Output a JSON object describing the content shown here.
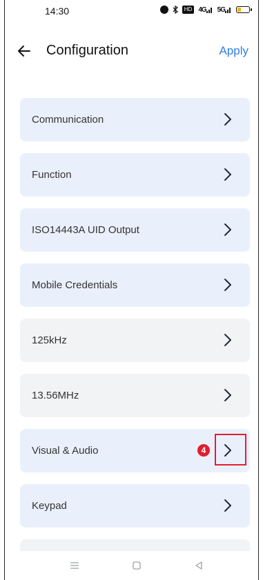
{
  "status": {
    "time": "14:30",
    "hd_label": "HD",
    "signal_1": "4G",
    "signal_2": "5G",
    "battery_level": 0.3
  },
  "header": {
    "title": "Configuration",
    "apply_label": "Apply"
  },
  "items": [
    {
      "label": "Communication"
    },
    {
      "label": "Function"
    },
    {
      "label": "ISO14443A UID Output"
    },
    {
      "label": "Mobile Credentials"
    },
    {
      "label": "125kHz"
    },
    {
      "label": "13.56MHz"
    },
    {
      "label": "Visual & Audio"
    },
    {
      "label": "Keypad"
    }
  ],
  "annotation": {
    "step_number": "4",
    "color": "#e11d2e"
  },
  "colors": {
    "accent": "#2f7ee6",
    "item_blue": "#eaf0fb",
    "item_grey": "#f2f3f5"
  }
}
